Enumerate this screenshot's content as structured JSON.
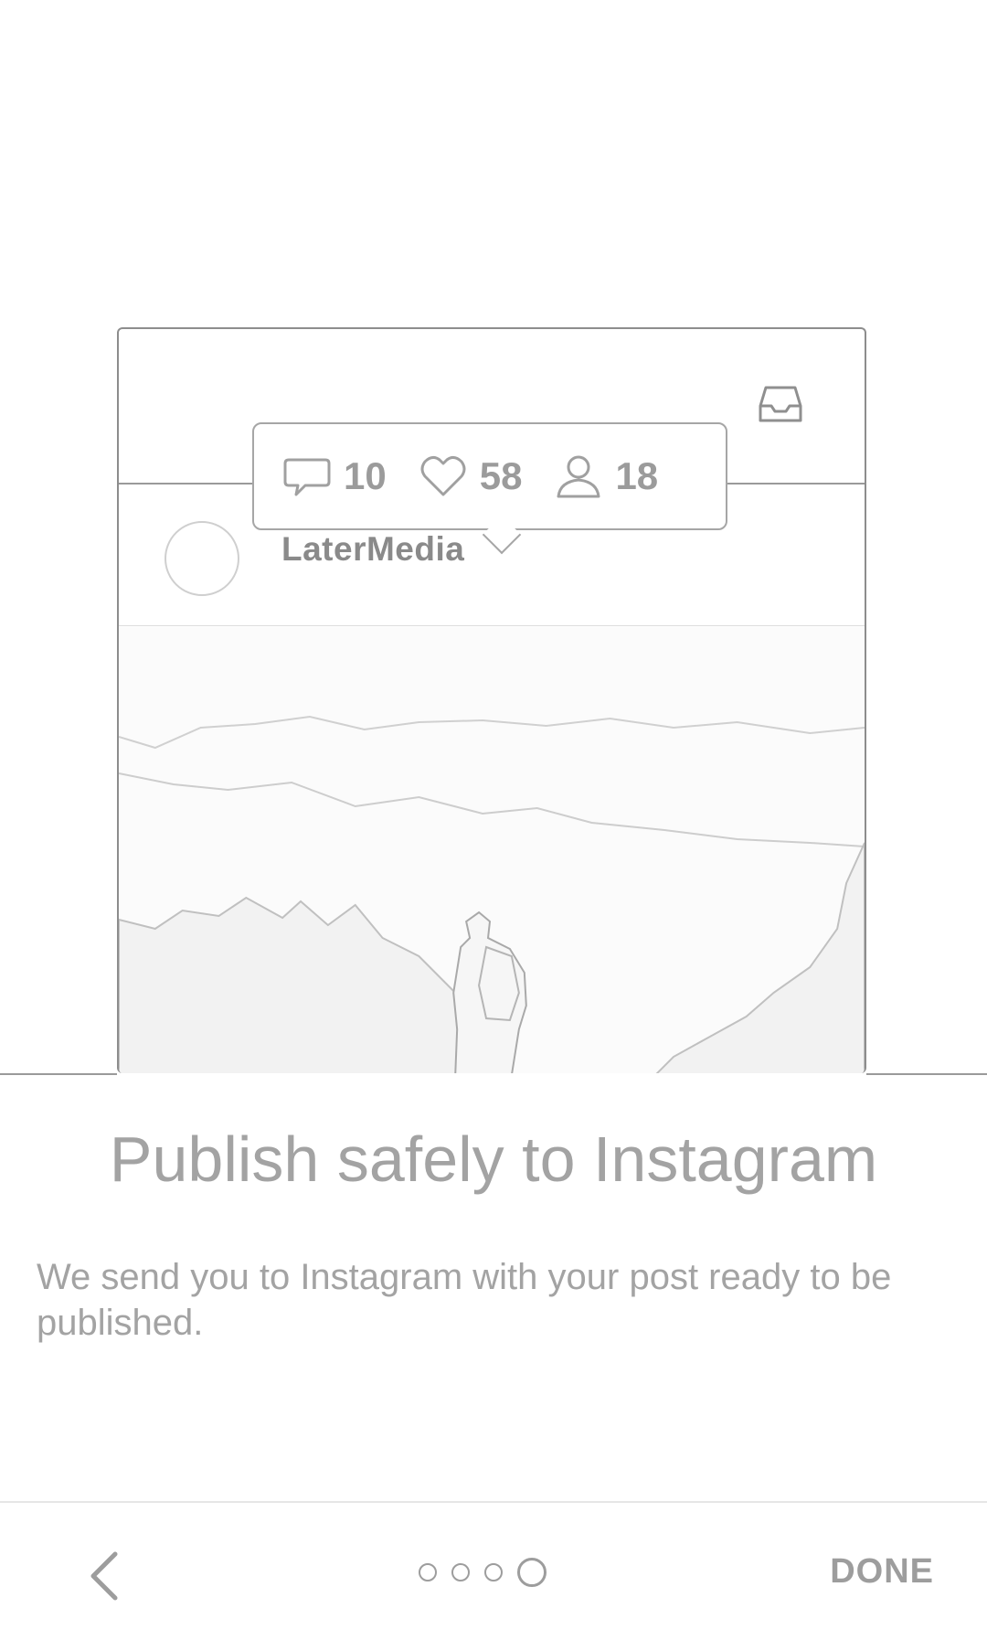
{
  "illustration": {
    "username": "LaterMedia",
    "stats": {
      "comments": "10",
      "likes": "58",
      "followers": "18"
    },
    "icons": [
      "inbox-icon",
      "comment-icon",
      "heart-icon",
      "person-icon"
    ]
  },
  "onboarding": {
    "headline": "Publish safely to Instagram",
    "body": "We send you to Instagram with your post ready to be published."
  },
  "navigation": {
    "back_icon": "chevron-left-icon",
    "done_label": "DONE",
    "page_count": 4,
    "current_page": 4
  },
  "colors": {
    "background": "#ffffff",
    "text": "#a3a3a3",
    "line": "#9a9a9a"
  }
}
